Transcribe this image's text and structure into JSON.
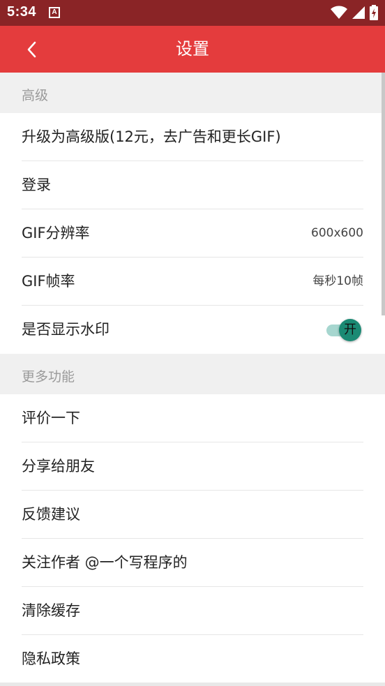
{
  "status_bar": {
    "time": "5:34",
    "app_icon_glyph": "A",
    "icons": [
      "wifi-icon",
      "signal-icon",
      "battery-charging-icon"
    ]
  },
  "app_bar": {
    "back_icon": "chevron-left-icon",
    "title": "设置"
  },
  "sections": [
    {
      "header": "高级",
      "items": [
        {
          "label": "升级为高级版(12元，去广告和更长GIF)"
        },
        {
          "label": "登录"
        },
        {
          "label": "GIF分辨率",
          "value": "600x600"
        },
        {
          "label": "GIF帧率",
          "value": "每秒10帧"
        },
        {
          "label": "是否显示水印",
          "toggle": {
            "on": true,
            "text": "开"
          }
        }
      ]
    },
    {
      "header": "更多功能",
      "items": [
        {
          "label": "评价一下"
        },
        {
          "label": "分享给朋友"
        },
        {
          "label": "反馈建议"
        },
        {
          "label": "关注作者 @一个写程序的"
        },
        {
          "label": "清除缓存"
        },
        {
          "label": "隐私政策"
        }
      ]
    }
  ],
  "colors": {
    "status_bar": "#8a2426",
    "app_bar": "#e43c3d",
    "section_bg": "#f0f0f0",
    "toggle_thumb": "#1b8a74",
    "toggle_track": "#a6d6cf"
  }
}
